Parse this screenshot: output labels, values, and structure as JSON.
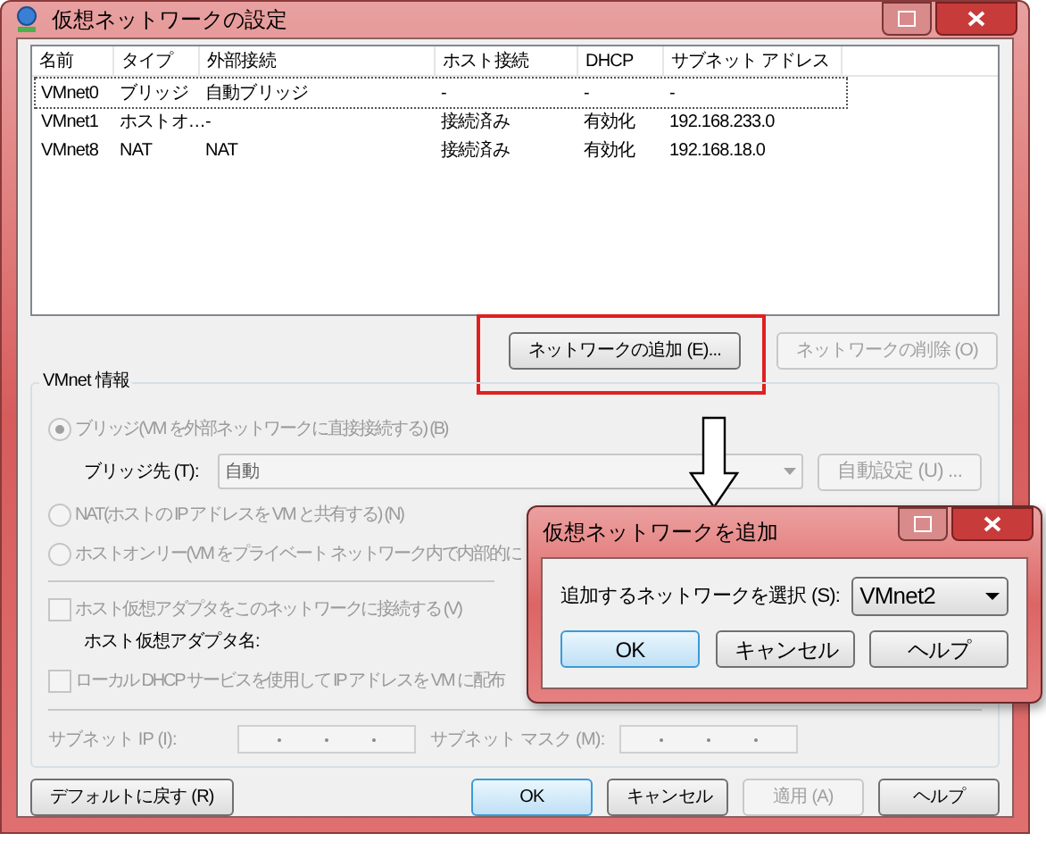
{
  "window": {
    "title": "仮想ネットワークの設定"
  },
  "network_table": {
    "columns": [
      "名前",
      "タイプ",
      "外部接続",
      "ホスト接続",
      "DHCP",
      "サブネット アドレス"
    ],
    "rows": [
      {
        "cells": [
          "VMnet0",
          "ブリッジ",
          "自動ブリッジ",
          "-",
          "-",
          "-"
        ],
        "selected": true
      },
      {
        "cells": [
          "VMnet1",
          "ホストオ…",
          "-",
          "接続済み",
          "有効化",
          "192.168.233.0"
        ],
        "selected": false
      },
      {
        "cells": [
          "VMnet8",
          "NAT",
          "NAT",
          "接続済み",
          "有効化",
          "192.168.18.0"
        ],
        "selected": false
      }
    ]
  },
  "network_buttons": [
    {
      "label": "ネットワークの追加 (E)...",
      "disabled": false,
      "highlighted": true
    },
    {
      "label": "ネットワークの削除 (O)",
      "disabled": true,
      "highlighted": false
    }
  ],
  "vmnet_info": {
    "title": "VMnet 情報",
    "bridge_option": {
      "label": "ブリッジ(VM を外部ネットワークに直接接続する) (B)",
      "selected": true,
      "disabled": true
    },
    "bridge_to": {
      "label": "ブリッジ先 (T):",
      "value": "自動",
      "disabled": true
    },
    "auto_settings": {
      "label": "自動設定 (U) ...",
      "disabled": true
    },
    "nat_option": {
      "label": "NAT(ホストの IP アドレスを VM と共有する) (N)",
      "selected": false,
      "disabled": true
    },
    "host_only_option": {
      "label": "ホストオンリー(VM をプライベート ネットワーク内で内部的に",
      "selected": false,
      "disabled": true
    },
    "connect_adapter": {
      "label": "ホスト仮想アダプタをこのネットワークに接続する (V)",
      "checked": false,
      "disabled": true
    },
    "adapter_name_label": "ホスト仮想アダプタ名:",
    "local_dhcp": {
      "label": "ローカル DHCP サービスを使用して IP アドレスを VM に配布",
      "checked": false,
      "disabled": true
    },
    "subnet_ip": {
      "label": "サブネット IP (I):",
      "disabled": true
    },
    "subnet_mask": {
      "label": "サブネット マスク (M):",
      "disabled": true
    }
  },
  "footer_buttons": [
    {
      "label": "デフォルトに戻す (R)",
      "disabled": false,
      "default": false
    },
    {
      "label": "OK",
      "disabled": false,
      "default": true
    },
    {
      "label": "キャンセル",
      "disabled": false,
      "default": false
    },
    {
      "label": "適用 (A)",
      "disabled": true,
      "default": false
    },
    {
      "label": "ヘルプ",
      "disabled": false,
      "default": false
    }
  ],
  "add_dialog": {
    "title": "仮想ネットワークを追加",
    "select_label": "追加するネットワークを選択 (S):",
    "select_value": "VMnet2",
    "buttons": [
      {
        "label": "OK",
        "default": true
      },
      {
        "label": "キャンセル",
        "default": false
      },
      {
        "label": "ヘルプ",
        "default": false
      }
    ]
  }
}
